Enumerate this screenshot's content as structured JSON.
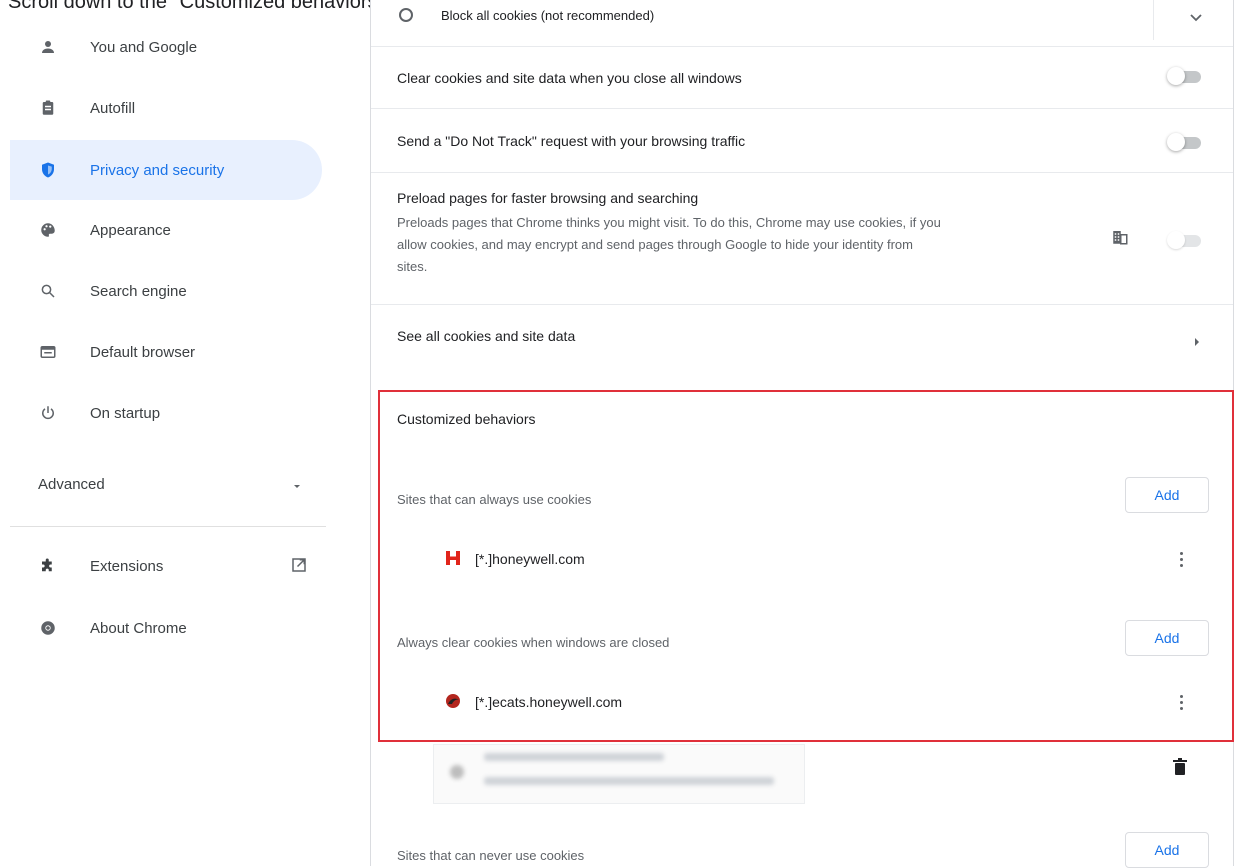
{
  "caption": "Scroll down to the \"Customized behaviors\" area.",
  "sidebar": {
    "items": [
      {
        "label": "You and Google",
        "icon": "person-icon"
      },
      {
        "label": "Autofill",
        "icon": "clipboard-icon"
      },
      {
        "label": "Privacy and security",
        "icon": "shield-icon",
        "active": true
      },
      {
        "label": "Appearance",
        "icon": "palette-icon"
      },
      {
        "label": "Search engine",
        "icon": "search-icon"
      },
      {
        "label": "Default browser",
        "icon": "browser-icon"
      },
      {
        "label": "On startup",
        "icon": "power-icon"
      }
    ],
    "advanced_label": "Advanced",
    "extensions_label": "Extensions",
    "about_label": "About Chrome"
  },
  "main": {
    "block_all_label": "Block all cookies (not recommended)",
    "clear_on_close_label": "Clear cookies and site data when you close all windows",
    "do_not_track_label": "Send a \"Do Not Track\" request with your browsing traffic",
    "preload_title": "Preload pages for faster browsing and searching",
    "preload_desc_1": "Preloads pages that Chrome thinks you might visit. To do this, Chrome may use cookies, if you",
    "preload_desc_2": "allow cookies, and may encrypt and send pages through Google to hide your identity from",
    "preload_desc_3": "sites.",
    "see_all_label": "See all cookies and site data",
    "customized_title": "Customized behaviors",
    "always_use_label": "Sites that can always use cookies",
    "always_use_site": "[*.]honeywell.com",
    "always_clear_label": "Always clear cookies when windows are closed",
    "always_clear_site": "[*.]ecats.honeywell.com",
    "never_use_label": "Sites that can never use cookies",
    "add_label": "Add"
  },
  "colors": {
    "accent": "#1a73e8",
    "highlight_border": "#e0303a",
    "honeywell_red": "#e1251b"
  }
}
